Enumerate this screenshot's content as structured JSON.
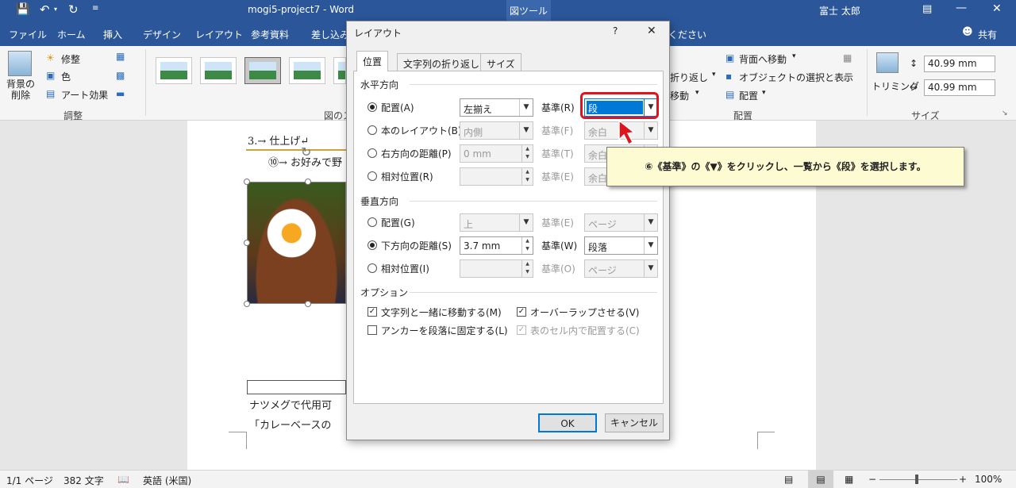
{
  "window": {
    "title": "mogi5-project7  -  Word",
    "context_tab": "図ツール",
    "user": "富士 太郎"
  },
  "ribbon_tabs": [
    "ファイル",
    "ホーム",
    "挿入",
    "デザイン",
    "レイアウト",
    "参考資料",
    "差し込み",
    "ください"
  ],
  "share_label": "共有",
  "ribbon": {
    "background_remove": "背景の削除",
    "corrections": "修整",
    "color": "色",
    "artistic_effects": "アート効果",
    "group_adjust": "調整",
    "group_styles": "図のス",
    "text_wrap": "折り返し",
    "bring_forward": "背面へ移動",
    "selection_pane": "オブジェクトの選択と表示",
    "forward": "移動",
    "align": "配置",
    "group_arrange": "配置",
    "crop": "トリミング",
    "height": "40.99 mm",
    "width": "40.99 mm",
    "group_size": "サイズ"
  },
  "document": {
    "heading": "3.→ 仕上げ↵",
    "step": "⑩→ お好みで野",
    "line1": "ナツメグで代用可",
    "line2": "「カレーベースの"
  },
  "dialog": {
    "title": "レイアウト",
    "help": "?",
    "close": "✕",
    "tabs": [
      "位置",
      "文字列の折り返し",
      "サイズ"
    ],
    "horizontal": {
      "section": "水平方向",
      "rows": [
        {
          "label": "配置(A)",
          "selected": true,
          "value": "左揃え",
          "ref_label": "基準(R)",
          "ref_value": "段",
          "enabled": true
        },
        {
          "label": "本のレイアウト(B)",
          "selected": false,
          "value": "内側",
          "ref_label": "基準(F)",
          "ref_value": "余白",
          "enabled": false
        },
        {
          "label": "右方向の距離(P)",
          "selected": false,
          "value": "0 mm",
          "ref_label": "基準(T)",
          "ref_value": "余白",
          "enabled": false
        },
        {
          "label": "相対位置(R)",
          "selected": false,
          "value": "",
          "ref_label": "基準(E)",
          "ref_value": "余白",
          "enabled": false
        }
      ]
    },
    "vertical": {
      "section": "垂直方向",
      "rows": [
        {
          "label": "配置(G)",
          "selected": false,
          "value": "上",
          "ref_label": "基準(E)",
          "ref_value": "ページ",
          "enabled": false
        },
        {
          "label": "下方向の距離(S)",
          "selected": true,
          "value": "3.7 mm",
          "ref_label": "基準(W)",
          "ref_value": "段落",
          "enabled": true
        },
        {
          "label": "相対位置(I)",
          "selected": false,
          "value": "",
          "ref_label": "基準(O)",
          "ref_value": "ページ",
          "enabled": false
        }
      ]
    },
    "options": {
      "section": "オプション",
      "items": [
        {
          "label": "文字列と一緒に移動する(M)",
          "checked": true,
          "enabled": true
        },
        {
          "label": "オーバーラップさせる(V)",
          "checked": true,
          "enabled": true
        },
        {
          "label": "アンカーを段落に固定する(L)",
          "checked": false,
          "enabled": true
        },
        {
          "label": "表のセル内で配置する(C)",
          "checked": true,
          "enabled": false
        }
      ]
    },
    "ok": "OK",
    "cancel": "キャンセル"
  },
  "callout": "⑥《基準》の《▼》をクリックし、一覧から《段》を選択します。",
  "status": {
    "page": "1/1 ページ",
    "words": "382 文字",
    "language": "英語 (米国)",
    "zoom": "100%"
  },
  "colors": {
    "titlebar": "#2b579a",
    "highlight": "#e0141c",
    "callout_bg": "#fdfbd2",
    "selection": "#0078d7"
  }
}
